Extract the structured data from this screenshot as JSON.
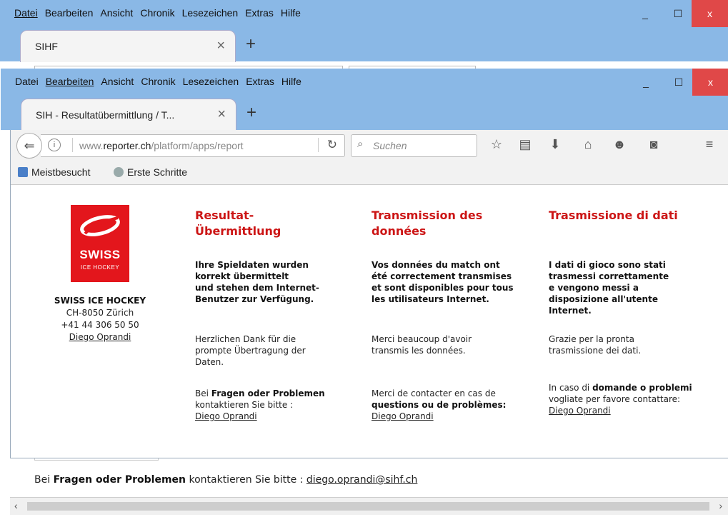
{
  "menu": [
    "Datei",
    "Bearbeiten",
    "Ansicht",
    "Chronik",
    "Lesezeichen",
    "Extras",
    "Hilfe"
  ],
  "back_window": {
    "tab_title": "SIHF",
    "footer": {
      "prefix": "Bei ",
      "bold": "Fragen oder Problemen",
      "middle": " kontaktieren Sie bitte : ",
      "email": "diego.oprandi@sihf.ch"
    }
  },
  "front_window": {
    "tab_title": "SIH - Resultatübermittlung / T...",
    "url_prefix": "www.",
    "url_domain": "reporter.ch",
    "url_path": "/platform/apps/report",
    "search_placeholder": "Suchen",
    "bookmarks": [
      "Meistbesucht",
      "Erste Schritte"
    ]
  },
  "window_controls": {
    "minimize": "_",
    "maximize": "☐",
    "close": "x"
  },
  "organization": {
    "logo_line1": "SWISS",
    "logo_line2": "ICE HOCKEY",
    "name": "SWISS ICE HOCKEY",
    "address": "CH-8050 Zürich",
    "phone": "+41 44 306 50 50",
    "contact_name": "Diego Oprandi"
  },
  "columns": [
    {
      "heading_line1": "Resultat-",
      "heading_line2": "Übermittlung",
      "confirm": [
        "Ihre Spieldaten wurden",
        "korrekt übermittelt",
        "und stehen dem Internet-",
        "Benutzer zur Verfügung."
      ],
      "thanks": [
        "Herzlichen Dank für die",
        "prompte Übertragung der",
        "Daten."
      ],
      "contact_pre": "Bei ",
      "contact_bold": "Fragen oder Problemen",
      "contact_post": "kontaktieren Sie bitte :",
      "contact_link": "Diego Oprandi"
    },
    {
      "heading_line1": "Transmission des",
      "heading_line2": "données",
      "confirm": [
        "Vos données du match ont",
        "été correctement transmises",
        "et sont disponibles pour tous",
        "les utilisateurs Internet."
      ],
      "thanks": [
        "Merci beaucoup d'avoir",
        "transmis les données."
      ],
      "contact_pre": "Merci de contacter en cas de",
      "contact_bold": "questions ou de problèmes:",
      "contact_post": "",
      "contact_link": "Diego Oprandi"
    },
    {
      "heading_line1": "Trasmissione di dati",
      "heading_line2": "",
      "confirm": [
        "I dati di gioco sono stati",
        "trasmessi correttamente",
        "e vengono messi a",
        "disposizione all'utente",
        "Internet."
      ],
      "thanks": [
        "Grazie per la pronta",
        "trasmissione dei dati."
      ],
      "contact_pre": "In caso di ",
      "contact_bold": "domande o problemi",
      "contact_post": " vogliate per favore contattare:",
      "contact_link": "Diego Oprandi"
    }
  ],
  "colors": {
    "titlebar": "#8ab8e6",
    "brand_red": "#e3161c",
    "heading_red": "#cc1515",
    "close_button": "#e04848"
  },
  "icons": [
    "info-icon",
    "reload-icon",
    "search-icon",
    "star-icon",
    "reader-icon",
    "download-icon",
    "home-icon",
    "smiley-icon",
    "pocket-icon",
    "hamburger-menu-icon"
  ]
}
